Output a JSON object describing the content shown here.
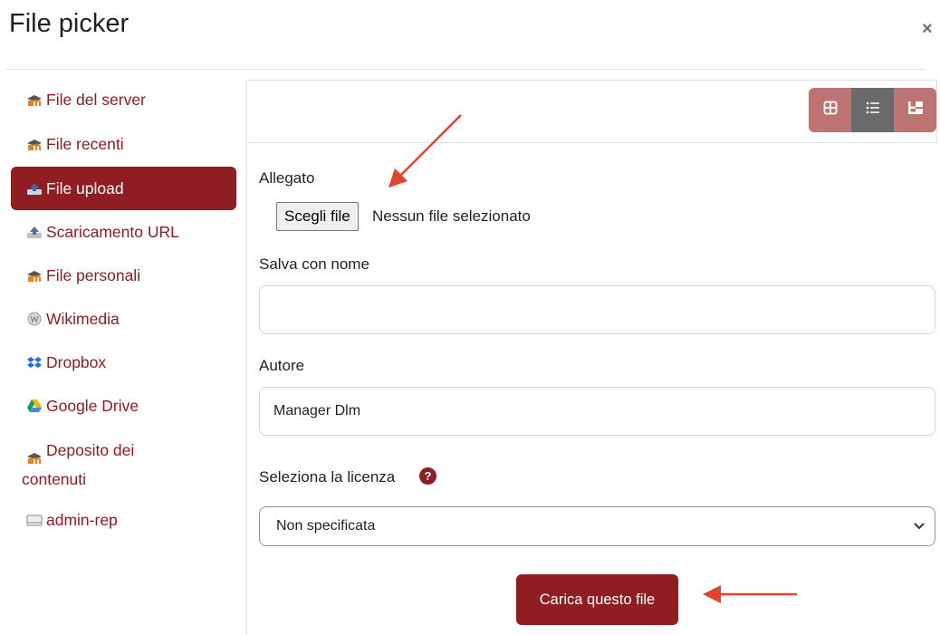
{
  "dialog": {
    "title": "File picker",
    "close_glyph": "×"
  },
  "sidebar": {
    "items": [
      {
        "label": "File del server",
        "icon": "moodle-icon",
        "active": false
      },
      {
        "label": "File recenti",
        "icon": "moodle-icon",
        "active": false
      },
      {
        "label": "File upload",
        "icon": "upload-icon",
        "active": true
      },
      {
        "label": "Scaricamento URL",
        "icon": "url-download-icon",
        "active": false
      },
      {
        "label": "File personali",
        "icon": "moodle-icon",
        "active": false
      },
      {
        "label": "Wikimedia",
        "icon": "wikimedia-icon",
        "active": false
      },
      {
        "label": "Dropbox",
        "icon": "dropbox-icon",
        "active": false
      },
      {
        "label": "Google Drive",
        "icon": "google-drive-icon",
        "active": false
      },
      {
        "label_line1": "Deposito dei",
        "label_line2": "contenuti",
        "icon": "moodle-icon",
        "active": false
      },
      {
        "label": "admin-rep",
        "icon": "folder-icon",
        "active": false
      }
    ]
  },
  "toolbar": {
    "view_icons": [
      "grid-view-icon",
      "list-view-icon",
      "tree-view-icon"
    ],
    "selected_view": "list-view-icon"
  },
  "form": {
    "attachment_label": "Allegato",
    "choose_file_button": "Scegli file",
    "no_file_text": "Nessun file selezionato",
    "save_as_label": "Salva con nome",
    "save_as_value": "",
    "author_label": "Autore",
    "author_value": "Manager Dlm",
    "license_label": "Seleziona la licenza",
    "license_help_glyph": "?",
    "license_value": "Non specificata",
    "upload_button": "Carica questo file"
  },
  "colors": {
    "accent": "#8f1d22",
    "view_button": "#bf7474",
    "view_button_selected": "#6a6a6a",
    "annotation_arrow": "#e0432e"
  }
}
